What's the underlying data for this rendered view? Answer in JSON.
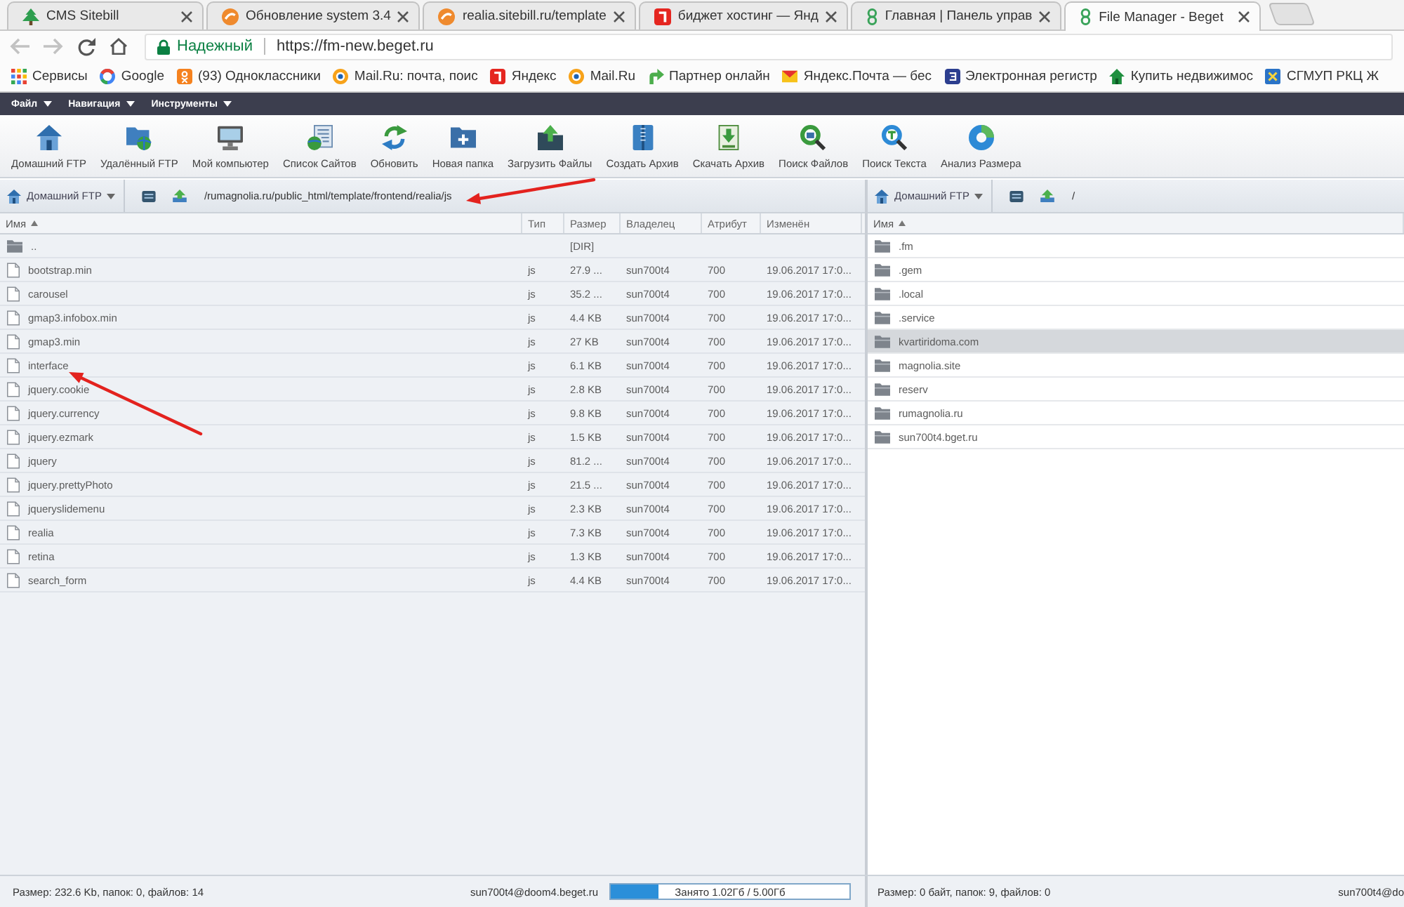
{
  "browser": {
    "tabs": [
      {
        "title": "CMS Sitebill",
        "selected": false
      },
      {
        "title": "Обновление system 3.4",
        "selected": false
      },
      {
        "title": "realia.sitebill.ru/template",
        "selected": false
      },
      {
        "title": "биджет хостинг — Янд",
        "selected": false
      },
      {
        "title": "Главная | Панель управ",
        "selected": false
      },
      {
        "title": "File Manager - Beget",
        "selected": true
      }
    ],
    "address_bar": {
      "security": "Надежный",
      "url": "https://fm-new.beget.ru"
    },
    "bookmarks": [
      {
        "label": "Сервисы"
      },
      {
        "label": "Google"
      },
      {
        "label": "(93) Одноклассники"
      },
      {
        "label": "Mail.Ru: почта, поис"
      },
      {
        "label": "Яндекс"
      },
      {
        "label": "Mail.Ru"
      },
      {
        "label": "Партнер онлайн"
      },
      {
        "label": "Яндекс.Почта — бес"
      },
      {
        "label": "Электронная регистр"
      },
      {
        "label": "Купить недвижимос"
      },
      {
        "label": "СГМУП РКЦ Ж"
      }
    ]
  },
  "menu": [
    {
      "label": "Файл"
    },
    {
      "label": "Навигация"
    },
    {
      "label": "Инструменты"
    }
  ],
  "toolbar": [
    {
      "label": "Домашний FTP"
    },
    {
      "label": "Удалённый FTP"
    },
    {
      "label": "Мой компьютер"
    },
    {
      "label": "Список Сайтов"
    },
    {
      "label": "Обновить"
    },
    {
      "label": "Новая папка"
    },
    {
      "label": "Загрузить Файлы"
    },
    {
      "label": "Создать Архив"
    },
    {
      "label": "Скачать Архив"
    },
    {
      "label": "Поиск Файлов"
    },
    {
      "label": "Поиск Текста"
    },
    {
      "label": "Анализ Размера"
    }
  ],
  "left_pane": {
    "location": "Домашний FTP",
    "path": "/rumagnolia.ru/public_html/template/frontend/realia/js",
    "columns": [
      {
        "label": "Имя",
        "sorted": true
      },
      {
        "label": "Тип",
        "sorted": false
      },
      {
        "label": "Размер",
        "sorted": false
      },
      {
        "label": "Владелец",
        "sorted": false
      },
      {
        "label": "Атрибут",
        "sorted": false
      },
      {
        "label": "Изменён",
        "sorted": false
      }
    ],
    "rows": [
      {
        "kind": "parent",
        "name": "..",
        "size": "[DIR]",
        "selected": false
      },
      {
        "kind": "file",
        "name": "bootstrap.min",
        "type": "js",
        "size": "27.9 ...",
        "owner": "sun700t4",
        "attr": "700",
        "modified": "19.06.2017 17:0...",
        "selected": false
      },
      {
        "kind": "file",
        "name": "carousel",
        "type": "js",
        "size": "35.2 ...",
        "owner": "sun700t4",
        "attr": "700",
        "modified": "19.06.2017 17:0...",
        "selected": false
      },
      {
        "kind": "file",
        "name": "gmap3.infobox.min",
        "type": "js",
        "size": "4.4 KB",
        "owner": "sun700t4",
        "attr": "700",
        "modified": "19.06.2017 17:0...",
        "selected": false
      },
      {
        "kind": "file",
        "name": "gmap3.min",
        "type": "js",
        "size": "27 KB",
        "owner": "sun700t4",
        "attr": "700",
        "modified": "19.06.2017 17:0...",
        "selected": false
      },
      {
        "kind": "file",
        "name": "interface",
        "type": "js",
        "size": "6.1 KB",
        "owner": "sun700t4",
        "attr": "700",
        "modified": "19.06.2017 17:0...",
        "selected": false
      },
      {
        "kind": "file",
        "name": "jquery.cookie",
        "type": "js",
        "size": "2.8 KB",
        "owner": "sun700t4",
        "attr": "700",
        "modified": "19.06.2017 17:0...",
        "selected": false
      },
      {
        "kind": "file",
        "name": "jquery.currency",
        "type": "js",
        "size": "9.8 KB",
        "owner": "sun700t4",
        "attr": "700",
        "modified": "19.06.2017 17:0...",
        "selected": false
      },
      {
        "kind": "file",
        "name": "jquery.ezmark",
        "type": "js",
        "size": "1.5 KB",
        "owner": "sun700t4",
        "attr": "700",
        "modified": "19.06.2017 17:0...",
        "selected": false
      },
      {
        "kind": "file",
        "name": "jquery",
        "type": "js",
        "size": "81.2 ...",
        "owner": "sun700t4",
        "attr": "700",
        "modified": "19.06.2017 17:0...",
        "selected": false
      },
      {
        "kind": "file",
        "name": "jquery.prettyPhoto",
        "type": "js",
        "size": "21.5 ...",
        "owner": "sun700t4",
        "attr": "700",
        "modified": "19.06.2017 17:0...",
        "selected": false
      },
      {
        "kind": "file",
        "name": "jqueryslidemenu",
        "type": "js",
        "size": "2.3 KB",
        "owner": "sun700t4",
        "attr": "700",
        "modified": "19.06.2017 17:0...",
        "selected": false
      },
      {
        "kind": "file",
        "name": "realia",
        "type": "js",
        "size": "7.3 KB",
        "owner": "sun700t4",
        "attr": "700",
        "modified": "19.06.2017 17:0...",
        "selected": false
      },
      {
        "kind": "file",
        "name": "retina",
        "type": "js",
        "size": "1.3 KB",
        "owner": "sun700t4",
        "attr": "700",
        "modified": "19.06.2017 17:0...",
        "selected": false
      },
      {
        "kind": "file",
        "name": "search_form",
        "type": "js",
        "size": "4.4 KB",
        "owner": "sun700t4",
        "attr": "700",
        "modified": "19.06.2017 17:0...",
        "selected": false
      }
    ]
  },
  "right_pane": {
    "location": "Домашний FTP",
    "path": "/",
    "columns": [
      {
        "label": "Имя",
        "sorted": true
      }
    ],
    "rows": [
      {
        "kind": "folder",
        "name": ".fm",
        "selected": false
      },
      {
        "kind": "folder",
        "name": ".gem",
        "selected": false
      },
      {
        "kind": "folder",
        "name": ".local",
        "selected": false
      },
      {
        "kind": "folder",
        "name": ".service",
        "selected": false
      },
      {
        "kind": "folder",
        "name": "kvartiridoma.com",
        "selected": true
      },
      {
        "kind": "folder",
        "name": "magnolia.site",
        "selected": false
      },
      {
        "kind": "folder",
        "name": "reserv",
        "selected": false
      },
      {
        "kind": "folder",
        "name": "rumagnolia.ru",
        "selected": false
      },
      {
        "kind": "folder",
        "name": "sun700t4.bget.ru",
        "selected": false
      }
    ]
  },
  "status_bar": {
    "left": {
      "summary": "Размер: 232.6 Kb, папок: 0, файлов: 14",
      "account": "sun700t4@doom4.beget.ru",
      "storage": {
        "label": "Занято 1.02Гб / 5.00Гб",
        "level": 0.2
      }
    },
    "right": {
      "summary": "Размер: 0 байт, папок: 9, файлов: 0",
      "account": "sun700t4@do"
    }
  },
  "annotations": [
    {
      "kind": "arrow"
    },
    {
      "kind": "arrow"
    }
  ]
}
